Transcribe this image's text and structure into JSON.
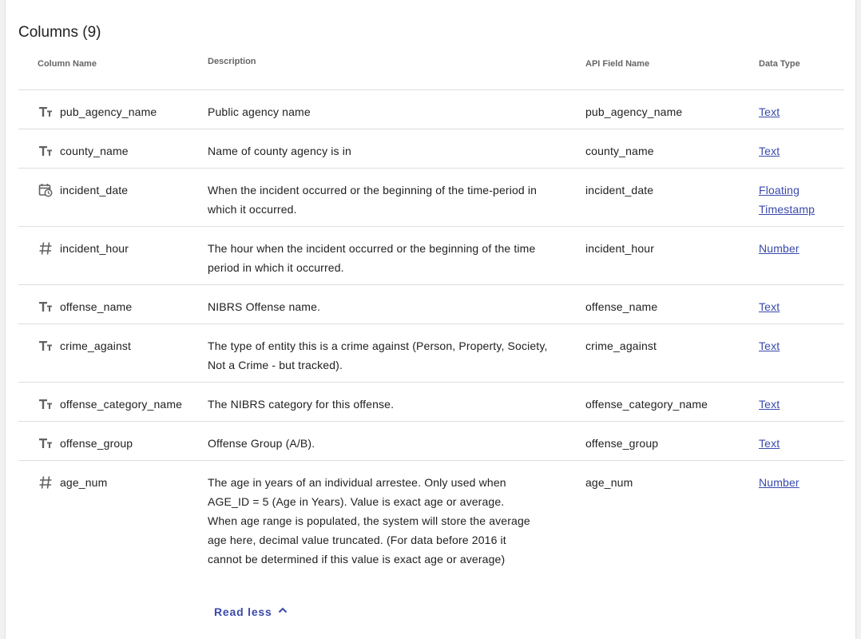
{
  "section": {
    "title": "Columns (9)"
  },
  "headers": {
    "column_name": "Column Name",
    "description": "Description",
    "api_field_name": "API Field Name",
    "data_type": "Data Type"
  },
  "rows": [
    {
      "icon": "text-type-icon",
      "name": "pub_agency_name",
      "description": "Public agency name",
      "api": "pub_agency_name",
      "type": "Text"
    },
    {
      "icon": "text-type-icon",
      "name": "county_name",
      "description": "Name of county agency is in",
      "api": "county_name",
      "type": "Text"
    },
    {
      "icon": "calendar-clock-icon",
      "name": "incident_date",
      "description": "When the incident occurred or the beginning of the time-period in which it occurred.",
      "api": "incident_date",
      "type": "Floating Timestamp"
    },
    {
      "icon": "number-hash-icon",
      "name": "incident_hour",
      "description": "The hour when the incident occurred or the beginning of the time period in which it occurred.",
      "api": "incident_hour",
      "type": "Number"
    },
    {
      "icon": "text-type-icon",
      "name": "offense_name",
      "description": "NIBRS Offense name.",
      "api": "offense_name",
      "type": "Text"
    },
    {
      "icon": "text-type-icon",
      "name": "crime_against",
      "description": "The type of entity this is a crime against (Person, Property, Society, Not a Crime - but tracked).",
      "api": "crime_against",
      "type": "Text"
    },
    {
      "icon": "text-type-icon",
      "name": "offense_category_name",
      "description": "The NIBRS category for this offense.",
      "api": "offense_category_name",
      "type": "Text"
    },
    {
      "icon": "text-type-icon",
      "name": "offense_group",
      "description": "Offense Group (A/B).",
      "api": "offense_group",
      "type": "Text"
    },
    {
      "icon": "number-hash-icon",
      "name": "age_num",
      "description": "The age in years of an individual arrestee. Only used when AGE_ID = 5 (Age in Years). Value is exact age or average. When age range is populated, the system will store the average age here, decimal value truncated. (For data before 2016 it cannot be determined if this value is exact age or average)",
      "api": "age_num",
      "type": "Number"
    }
  ],
  "read_less_label": "Read less",
  "colors": {
    "link": "#3949ab",
    "divider": "#dedede",
    "icon": "#616161"
  }
}
